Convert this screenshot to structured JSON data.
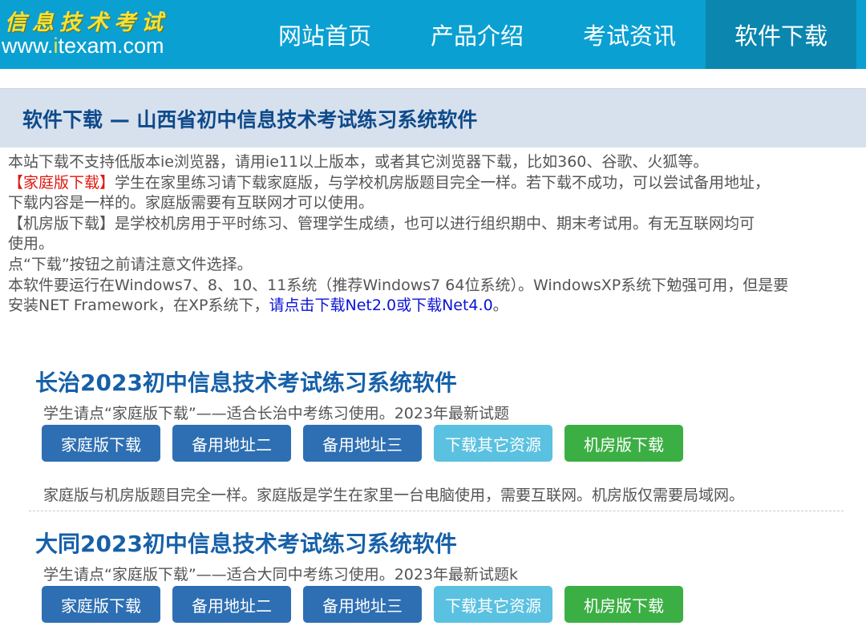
{
  "header": {
    "logo_cn": "信息技术考试",
    "logo_url_pre": "www.",
    "logo_url_hl": "i",
    "logo_url_post": "texam.com",
    "nav": [
      "网站首页",
      "产品介绍",
      "考试资讯",
      "软件下载"
    ],
    "active_index": 3
  },
  "page_title": "软件下载 — 山西省初中信息技术考试练习系统软件",
  "notice": {
    "line1": "本站下载不支持低版本ie浏览器，请用ie11以上版本，或者其它浏览器下载，比如360、谷歌、火狐等。",
    "family_tag": "【家庭版下载】",
    "family_text_a": "学生在家里练习请下载家庭版，与学校机房版题目完全一样。若下载不成功，可以尝试备用地址，",
    "family_text_b": "下载内容是一样的。家庭版需要有互联网才可以使用。",
    "lab_text_a": "【机房版下载】是学校机房用于平时练习、管理学生成绩，也可以进行组织期中、期末考试用。有无互联网均可",
    "lab_text_b": "使用。",
    "line_click": "点“下载”按钮之前请注意文件选择。",
    "os_text_a": "本软件要运行在Windows7、8、10、11系统（推荐Windows7 64位系统）。WindowsXP系统下勉强可用，但是要",
    "os_text_b": "安装NET Framework，在XP系统下，",
    "os_link": "请点击下载Net2.0或下载Net4.0",
    "os_end": "。"
  },
  "products": [
    {
      "title": "长治2023初中信息技术考试练习系统软件",
      "desc": "学生请点“家庭版下载”——适合长治中考练习使用。2023年最新试题",
      "buttons": [
        "家庭版下载",
        "备用地址二",
        "备用地址三",
        "下载其它资源",
        "机房版下载"
      ],
      "note": "家庭版与机房版题目完全一样。家庭版是学生在家里一台电脑使用，需要互联网。机房版仅需要局域网。"
    },
    {
      "title": "大同2023初中信息技术考试练习系统软件",
      "desc": "学生请点“家庭版下载”——适合大同中考练习使用。2023年最新试题k",
      "buttons": [
        "家庭版下载",
        "备用地址二",
        "备用地址三",
        "下载其它资源",
        "机房版下载"
      ]
    }
  ],
  "colors": {
    "header_bg": "#0aa0d2",
    "active_nav": "#0a86af",
    "title_bar": "#d7e1ee",
    "btn_primary": "#2e6fb3",
    "btn_info": "#5bc1e0",
    "btn_success": "#3caf44"
  }
}
